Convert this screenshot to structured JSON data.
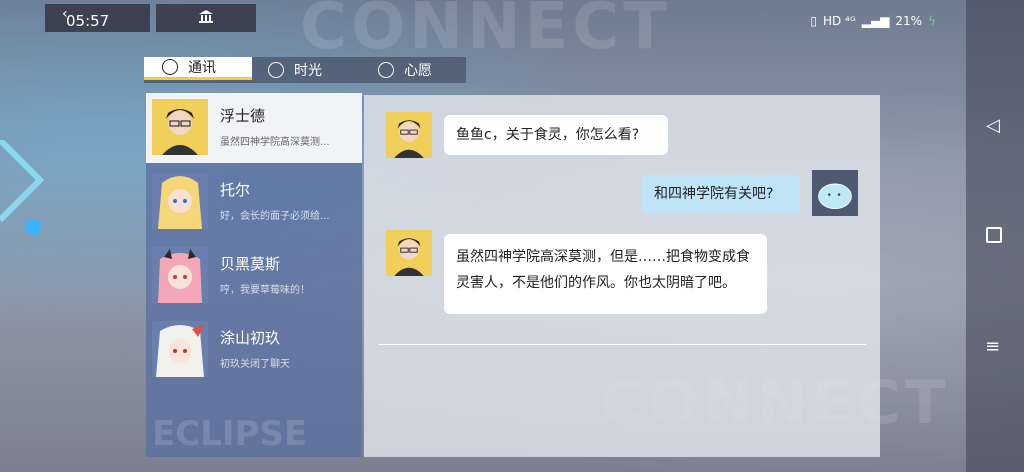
{
  "status": {
    "time": "05:57",
    "indicators": "HD ⁴ᴳ",
    "battery": "21%"
  },
  "tabs": [
    {
      "label": "通讯",
      "icon": "chat-icon",
      "active": true
    },
    {
      "label": "时光",
      "icon": "aperture-icon",
      "active": false
    },
    {
      "label": "心愿",
      "icon": "wish-icon",
      "active": false
    }
  ],
  "contacts": [
    {
      "name": "浮士德",
      "preview": "虽然四神学院高深莫测...",
      "active": true
    },
    {
      "name": "托尔",
      "preview": "好，会长的面子必须给..."
    },
    {
      "name": "贝黑莫斯",
      "preview": "哼，我要草莓味的！"
    },
    {
      "name": "涂山初玖",
      "preview": "初玖关闭了聊天"
    }
  ],
  "messages": [
    {
      "from": "浮士德",
      "text": "鱼鱼c，关于食灵，你怎么看?"
    },
    {
      "from": "me",
      "text": "和四神学院有关吧?"
    },
    {
      "from": "浮士德",
      "text": "虽然四神学院高深莫测，但是……把食物变成食灵害人，不是他们的作风。你也太阴暗了吧。"
    }
  ],
  "background_words": {
    "top": "CONNECT",
    "bottom": "CONNECT",
    "list": "ECLIPSE"
  }
}
